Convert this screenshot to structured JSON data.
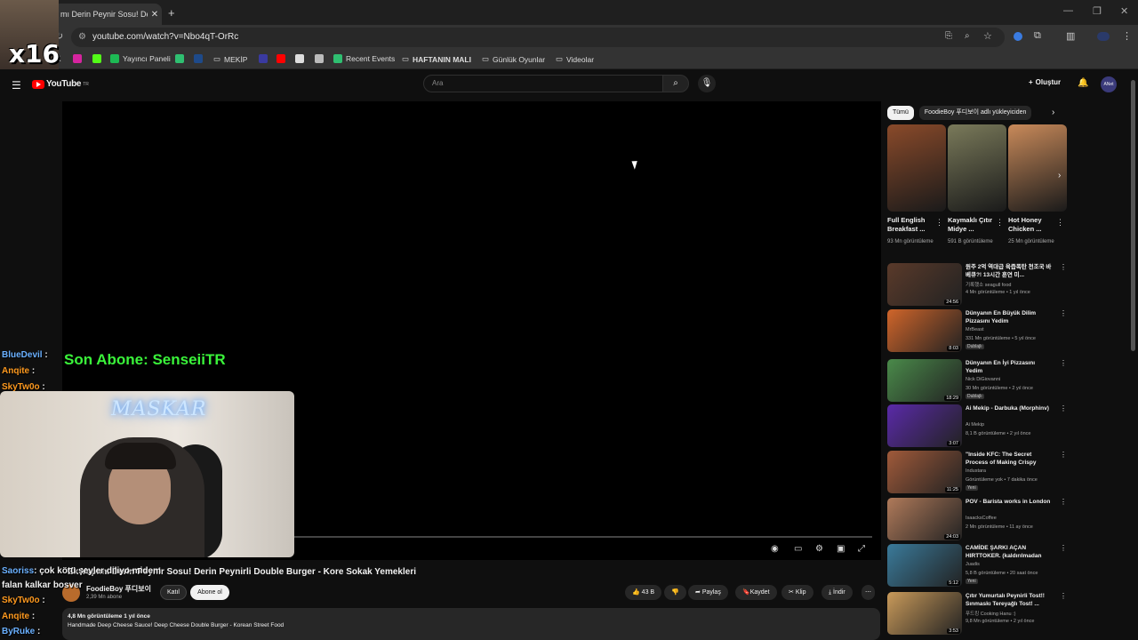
{
  "browser": {
    "tab_title": "mı Derin Peynir Sosu! De",
    "url": "youtube.com/watch?v=Nbo4qT-OrRc",
    "bookmarks": [
      {
        "label": "Yayıncı Paneli",
        "color": "#1db954"
      },
      {
        "label": "MEKİP",
        "color": "#888"
      },
      {
        "label": "Recent Events",
        "color": "#2fbf71"
      },
      {
        "label": "HAFTANIN MALI",
        "color": "#888"
      },
      {
        "label": "Günlük Oyunlar",
        "color": "#888"
      },
      {
        "label": "Videolar",
        "color": "#888"
      }
    ]
  },
  "youtube": {
    "logo_text": "YouTube",
    "logo_country": "TR",
    "search_placeholder": "Ara",
    "create_label": "Oluştur",
    "avatar_text": "ANet"
  },
  "video": {
    "title": "Ek Yapımı Derin Peynir Sosu! Derin Peynirli Double Burger - Kore Sokak Yemekleri",
    "channel": "FoodieBoy 푸디보이",
    "subscribers": "2,39 Mn abone",
    "join_label": "Katıl",
    "subscribe_label": "Abone ol",
    "likes": "43 B",
    "share_label": "Paylaş",
    "save_label": "Kaydet",
    "clip_label": "Klip",
    "download_label": "İndir",
    "views_line": "4,8 Mn görüntüleme  1 yıl önce",
    "description": "Handmade Deep Cheese Sauce! Deep Cheese Double Burger - Korean Street Food"
  },
  "sidebar": {
    "chips": [
      "Tümü",
      "FoodieBoy 푸디보이 adlı yükleyiciden"
    ],
    "shorts": [
      {
        "title": "Full English Breakfast ...",
        "views": "93 Mn görüntüleme",
        "color": "#8a4a2a"
      },
      {
        "title": "Kaymaklı Çıtır Midye ...",
        "views": "591 B görüntüleme",
        "color": "#7a7a5a"
      },
      {
        "title": "Hot Honey Chicken ...",
        "views": "25 Mn görüntüleme",
        "color": "#c98a5a"
      }
    ],
    "videos": [
      {
        "title": "원주 2억 역대급 육즙폭탄 천조국 바베큐?! 13시간 훈연 미...",
        "channel": "기록했소 seagull food",
        "meta": "4 Mn görüntüleme • 1 yıl önce",
        "duration": "24:56",
        "badge": "",
        "color": "#5a3a2a"
      },
      {
        "title": "Dünyanın En Büyük Dilim Pizzasını Yedim",
        "channel": "MrBeast",
        "meta": "331 Mn görüntüleme • 5 yıl önce",
        "duration": "8:03",
        "badge": "Dublajlı",
        "color": "#d0652a"
      },
      {
        "title": "Dünyanın En İyi Pizzasını Yedim",
        "channel": "Nick DiGiovanni",
        "meta": "30 Mn görüntüleme • 2 yıl önce",
        "duration": "18:29",
        "badge": "Dublajlı",
        "color": "#4a8a4a"
      },
      {
        "title": "Ai Mekip - Darbuka (Morphinv)",
        "channel": "Ai Mekip",
        "meta": "8,1 B görüntüleme • 2 yıl önce",
        "duration": "3:07",
        "badge": "",
        "color": "#5a2aa8"
      },
      {
        "title": "\"Inside KFC: The Secret Process of Making Crispy Original ...",
        "channel": "Industara",
        "meta": "Görüntüleme yok • 7 dakika önce",
        "duration": "11:25",
        "badge": "Yeni",
        "color": "#a05a3a"
      },
      {
        "title": "POV - Barista works in London",
        "channel": "IsaacksCoffee",
        "meta": "2 Mn görüntüleme • 11 ay önce",
        "duration": "24:03",
        "badge": "",
        "color": "#b07a5a"
      },
      {
        "title": "CAMİDE ŞARKI AÇAN HIRTTOKER. (kaldırılmadan izle)",
        "channel": "Juadis",
        "meta": "5,8 B görüntüleme • 20 saat önce",
        "duration": "5:12",
        "badge": "Yeni",
        "color": "#3a7a9a"
      },
      {
        "title": "Çıtır Yumurtalı Peynirli Tost!! Sınmaskı Tereyağlı Tost! ...",
        "channel": "푸드킹 Cooking Hanu :)",
        "meta": "9,8 Mn görüntüleme • 2 yıl önce",
        "duration": "3:53",
        "badge": "",
        "color": "#c99a5a"
      }
    ]
  },
  "overlay": {
    "multiplier": "x16",
    "last_sub": "Son Abone: SenseiiTR",
    "cam_sign": "MASKAR",
    "chat": [
      {
        "user": "BlueDevil",
        "text": ":"
      },
      {
        "user": "Anqite",
        "text": ":"
      },
      {
        "user": "SkyTw0o",
        "text": ":"
      },
      {
        "user": "Saoriss",
        "text": ": çok kötü şeyler diliyo midem"
      },
      {
        "user": "",
        "text": "falan kalkar bosver"
      },
      {
        "user": "SkyTw0o",
        "text": ":"
      },
      {
        "user": "Anqite",
        "text": ":"
      },
      {
        "user": "ByRuke",
        "text": ":"
      }
    ]
  }
}
